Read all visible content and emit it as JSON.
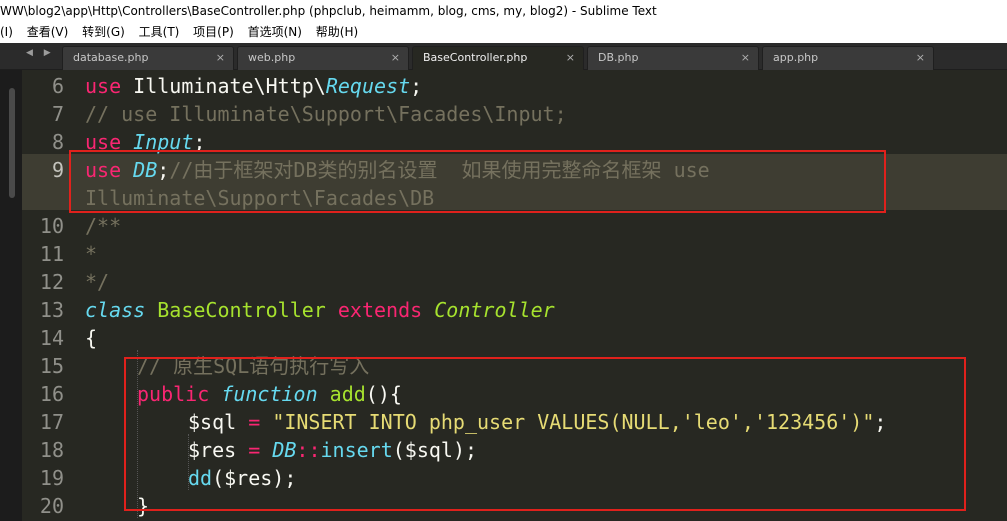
{
  "window": {
    "title": "WW\\blog2\\app\\Http\\Controllers\\BaseController.php (phpclub, heimamm, blog, cms, my, blog2) - Sublime Text"
  },
  "menu": [
    "(I)",
    "查看(V)",
    "转到(G)",
    "工具(T)",
    "项目(P)",
    "首选项(N)",
    "帮助(H)"
  ],
  "tab_nav": "◀ ▶",
  "tabs": [
    {
      "label": "database.php",
      "close": "×",
      "active": false
    },
    {
      "label": "web.php",
      "close": "×",
      "active": false
    },
    {
      "label": "BaseController.php",
      "close": "×",
      "active": true
    },
    {
      "label": "DB.php",
      "close": "×",
      "active": false
    },
    {
      "label": "app.php",
      "close": "×",
      "active": false
    }
  ],
  "line_numbers": [
    "6",
    "7",
    "8",
    "9",
    "",
    "10",
    "11",
    "12",
    "13",
    "14",
    "15",
    "16",
    "17",
    "18",
    "19",
    "20"
  ],
  "current_line": "9",
  "code": {
    "l6": {
      "kw": "use",
      "ns": " Illuminate\\Http\\",
      "cls": "Request",
      "end": ";"
    },
    "l7": "// use Illuminate\\Support\\Facades\\Input;",
    "l8": {
      "kw": "use",
      "cls": "Input",
      "end": ";"
    },
    "l9": {
      "kw": "use",
      "cls": "DB",
      "end": ";",
      "comment": "//由于框架对DB类的别名设置  如果使用完整命名框架 use"
    },
    "l9b": "Illuminate\\Support\\Facades\\DB",
    "l10": "/**",
    "l11": "*",
    "l12": "*/",
    "l13": {
      "kw1": "class",
      "name": "BaseController",
      "kw2": "extends",
      "parent": "Controller"
    },
    "l14": "{",
    "l15": "// 原生SQL语句执行写入",
    "l16": {
      "kw": "public",
      "fn": "function",
      "name": "add",
      "end": "(){"
    },
    "l17": {
      "var": "$sql",
      "op": "=",
      "str": "\"INSERT INTO php_user VALUES(",
      "null": "NULL",
      "str2": ",'leo','123456')\"",
      "end": ";"
    },
    "l18": {
      "var": "$res",
      "op": "=",
      "cls": "DB",
      "sep": "::",
      "method": "insert",
      "args": "($sql);"
    },
    "l19": {
      "fn": "dd",
      "args": "($res);"
    },
    "l20": "}"
  }
}
